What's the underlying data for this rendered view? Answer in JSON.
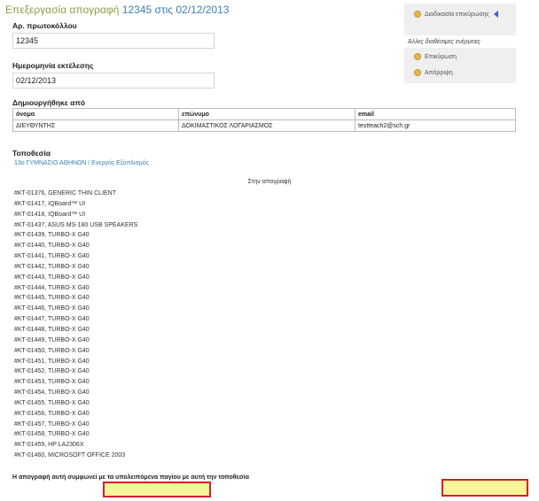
{
  "header": {
    "title_prefix": "Επεξεργασία απογραφή",
    "title_number": "12345 στις 02/12/2013"
  },
  "form": {
    "protocol_label": "Αρ. πρωτοκόλλου",
    "protocol_value": "12345",
    "date_label": "Ημερομηνία εκτέλεσης",
    "date_value": "02/12/2013",
    "created_by_label": "Δημιουργήθηκε από"
  },
  "sidebar": {
    "workflow": "Διαδικασία επικύρωσης",
    "other_actions": "Άλλες διαθέσιμες ενέργειες",
    "approve": "Επικύρωση",
    "reject": "Απόρριψη"
  },
  "creators": {
    "columns": [
      "όνομα",
      "επώνυμο",
      "email"
    ],
    "rows": [
      [
        "ΔΙΕΥΘΥΝΤΗΣ",
        "ΔΟΚΙΜΑΣΤΙΚΟΣ ΛΟΓΑΡΙΑΣΜΟΣ",
        "testteach2@sch.gr"
      ]
    ]
  },
  "location": {
    "label": "Τοποθεσία",
    "value": "13ο ΓΥΜΝΑΣΙΟ ΑΘΗΝΩΝ / Ενεργός Εξοπλισμός"
  },
  "items": {
    "heading": "Στην απογραφή",
    "list": [
      "#KT-01376, GENERIC THIN CLIENT",
      "#KT-01417, IQBoard™ UI",
      "#KT-01418, IQBoard™ UI",
      "#KT-01437, ASUS MS-180 USB SPEAKERS",
      "#KT-01439, TURBO-X G40",
      "#KT-01440, TURBO-X G40",
      "#KT-01441, TURBO-X G40",
      "#KT-01442, TURBO-X G40",
      "#KT-01443, TURBO-X G40",
      "#KT-01444, TURBO-X G40",
      "#KT-01445, TURBO-X G40",
      "#KT-01446, TURBO-X G40",
      "#KT-01447, TURBO-X G40",
      "#KT-01448, TURBO-X G40",
      "#KT-01449, TURBO-X G40",
      "#KT-01450, TURBO-X G40",
      "#KT-01451, TURBO-X G40",
      "#KT-01452, TURBO-X G40",
      "#KT-01453, TURBO-X G40",
      "#KT-01454, TURBO-X G40",
      "#KT-01455, TURBO-X G40",
      "#KT-01456, TURBO-X G40",
      "#KT-01457, TURBO-X G40",
      "#KT-01458, TURBO-X G40",
      "#KT-01459, HP LA2306X",
      "#KT-01460, MICROSOFT OFFICE 2003"
    ]
  },
  "footer": {
    "note": "Η απογραφή αυτή συμφωνεί με τα υπολειπόμενα παγίου με αυτή την τοποθεσία"
  },
  "colors": {
    "title": "#8aa04a",
    "link": "#3a7fb0",
    "highlight_border": "#d4202a",
    "highlight_fill": "#f7f59a"
  }
}
